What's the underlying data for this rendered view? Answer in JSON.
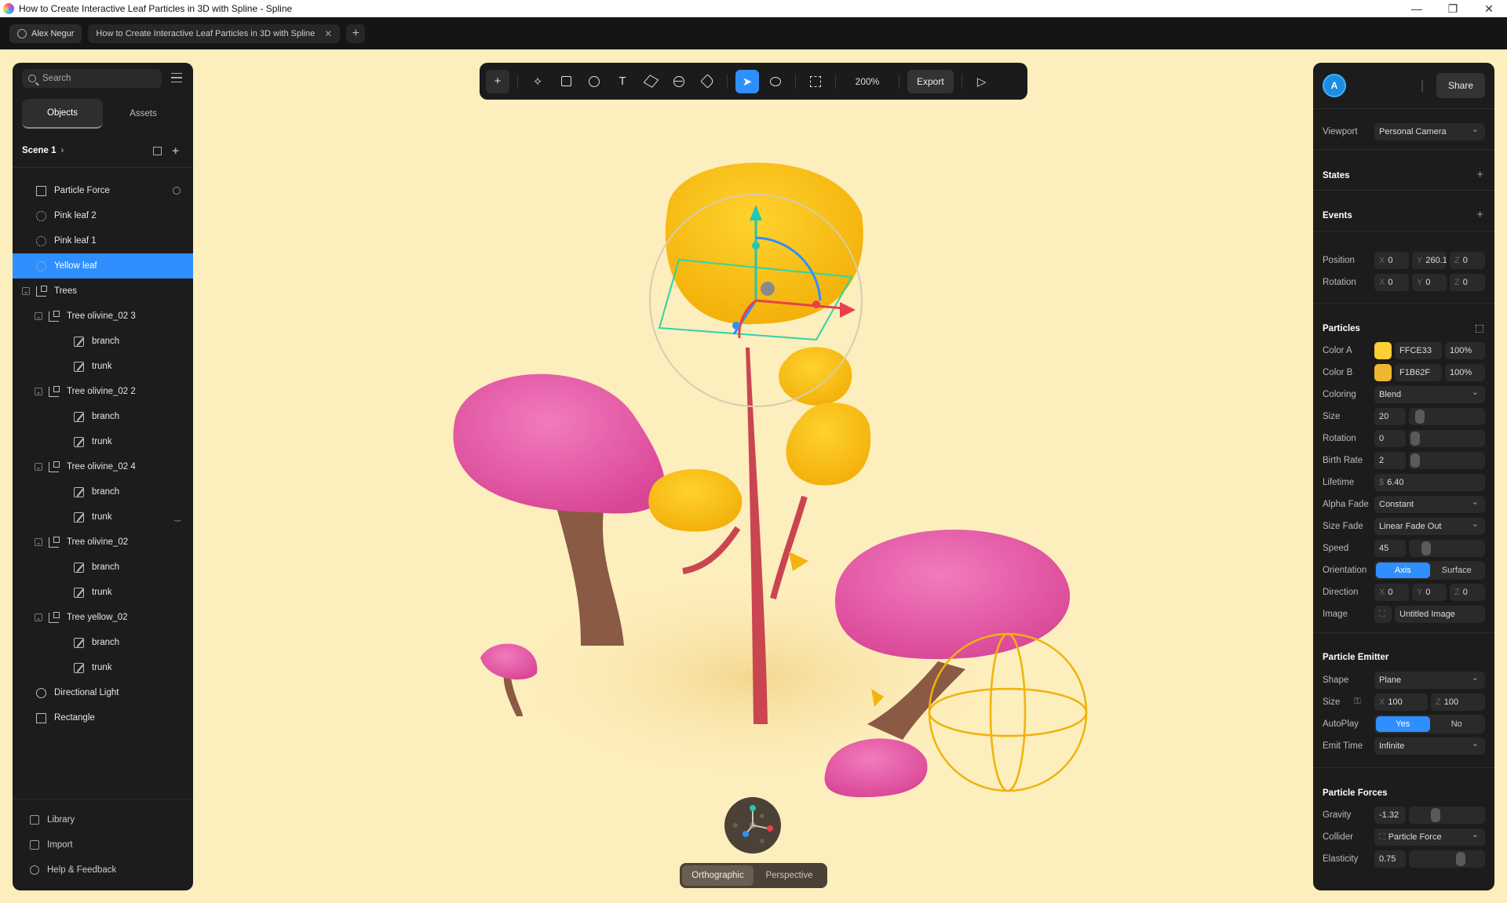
{
  "window": {
    "title": "How to Create Interactive Leaf Particles in 3D with Spline - Spline"
  },
  "tabbar": {
    "user": "Alex Negur",
    "doc_tab": "How to Create Interactive Leaf Particles in 3D with Spline"
  },
  "left_panel": {
    "search_placeholder": "Search",
    "tabs": [
      "Objects",
      "Assets"
    ],
    "scene": "Scene 1",
    "tree": [
      {
        "label": "Particle Force",
        "icon": "force",
        "indent": 0
      },
      {
        "label": "Pink leaf 2",
        "icon": "particle",
        "indent": 0
      },
      {
        "label": "Pink leaf 1",
        "icon": "particle",
        "indent": 0
      },
      {
        "label": "Yellow leaf",
        "icon": "particle",
        "indent": 0,
        "selected": true
      },
      {
        "label": "Trees",
        "icon": "group",
        "indent": 0,
        "expanded": true
      },
      {
        "label": "Tree olivine_02 3",
        "icon": "group",
        "indent": 1,
        "expanded": true
      },
      {
        "label": "branch",
        "icon": "shape",
        "indent": 2
      },
      {
        "label": "trunk",
        "icon": "shape",
        "indent": 2
      },
      {
        "label": "Tree olivine_02 2",
        "icon": "group",
        "indent": 1,
        "expanded": true
      },
      {
        "label": "branch",
        "icon": "shape",
        "indent": 2
      },
      {
        "label": "trunk",
        "icon": "shape",
        "indent": 2
      },
      {
        "label": "Tree olivine_02 4",
        "icon": "group",
        "indent": 1,
        "expanded": true
      },
      {
        "label": "branch",
        "icon": "shape",
        "indent": 2
      },
      {
        "label": "trunk",
        "icon": "shape",
        "indent": 2,
        "hidden_toggle": true
      },
      {
        "label": "Tree olivine_02",
        "icon": "group",
        "indent": 1,
        "expanded": true
      },
      {
        "label": "branch",
        "icon": "shape",
        "indent": 2
      },
      {
        "label": "trunk",
        "icon": "shape",
        "indent": 2
      },
      {
        "label": "Tree yellow_02",
        "icon": "group",
        "indent": 1,
        "expanded": true
      },
      {
        "label": "branch",
        "icon": "shape",
        "indent": 2
      },
      {
        "label": "trunk",
        "icon": "shape",
        "indent": 2
      },
      {
        "label": "Directional Light",
        "icon": "light",
        "indent": 0
      },
      {
        "label": "Rectangle",
        "icon": "rect",
        "indent": 0
      }
    ],
    "footer": [
      "Library",
      "Import",
      "Help & Feedback"
    ]
  },
  "toolbar": {
    "zoom": "200%",
    "export": "Export"
  },
  "right_panel": {
    "avatar_initial": "A",
    "share": "Share",
    "viewport_label": "Viewport",
    "viewport_value": "Personal Camera",
    "states": "States",
    "events": "Events",
    "position_label": "Position",
    "position": {
      "x": "0",
      "y": "260.1",
      "z": "0"
    },
    "rotation_label": "Rotation",
    "rotation": {
      "x": "0",
      "y": "0",
      "z": "0"
    },
    "particles": {
      "heading": "Particles",
      "color_a_label": "Color A",
      "color_a_hex": "FFCE33",
      "color_a_alpha": "100%",
      "color_a": "#FFCE33",
      "color_b_label": "Color B",
      "color_b_hex": "F1B62F",
      "color_b_alpha": "100%",
      "color_b": "#F1B62F",
      "coloring_label": "Coloring",
      "coloring": "Blend",
      "size_label": "Size",
      "size": "20",
      "rotation_label": "Rotation",
      "rotation": "0",
      "birth_rate_label": "Birth Rate",
      "birth_rate": "2",
      "lifetime_label": "Lifetime",
      "lifetime": "6.40",
      "alpha_fade_label": "Alpha Fade",
      "alpha_fade": "Constant",
      "size_fade_label": "Size Fade",
      "size_fade": "Linear Fade Out",
      "speed_label": "Speed",
      "speed": "45",
      "orientation_label": "Orientation",
      "orientation_options": [
        "Axis",
        "Surface"
      ],
      "direction_label": "Direction",
      "direction": {
        "x": "0",
        "y": "0",
        "z": "0"
      },
      "image_label": "Image",
      "image": "Untitled Image"
    },
    "emitter": {
      "heading": "Particle Emitter",
      "shape_label": "Shape",
      "shape": "Plane",
      "size_label": "Size",
      "size_x": "100",
      "size_z": "100",
      "autoplay_label": "AutoPlay",
      "autoplay_options": [
        "Yes",
        "No"
      ],
      "emit_time_label": "Emit Time",
      "emit_time": "Infinite"
    },
    "forces": {
      "heading": "Particle Forces",
      "gravity_label": "Gravity",
      "gravity": "-1.32",
      "collider_label": "Collider",
      "collider": "Particle Force",
      "elasticity_label": "Elasticity",
      "elasticity": "0.75"
    }
  },
  "camera_switch": [
    "Orthographic",
    "Perspective"
  ],
  "colors": {
    "accent": "#2F8FFF",
    "canvas": "#FDEEBD",
    "pink": "#E85AA6",
    "yellow": "#FFC21A",
    "trunk": "#8A5A44"
  }
}
